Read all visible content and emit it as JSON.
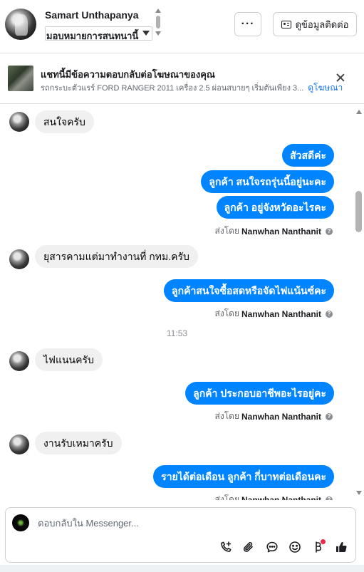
{
  "header": {
    "contact_name": "Samart Unthapanya",
    "assign_value": "มอบหมายการสนทนานี้",
    "more_label": "···",
    "contact_info_label": "ดูข้อมูลติดต่อ"
  },
  "ad_banner": {
    "title": "แชทนี้มีข้อความตอบกลับต่อโฆษณาของคุณ",
    "subtitle": "รถกระบะตัวแรร์ FORD RANGER 2011 เครื่อง 2.5 ผ่อนสบายๆ เริ่มต้นเพียง 3...",
    "link": "ดูโฆษณา"
  },
  "messages": {
    "m1": "สนใจครับ",
    "m2": "สัวสดีค่ะ",
    "m3": "ลูกค้า สนใจรถรุ่นนี้อยู่นะคะ",
    "m4": "ลูกค้า อยู่จังหวัดอะไรคะ",
    "m5": "ยุสารคามแต่มาทำงานที่ กทม.ครับ",
    "m6": "ลูกค้าสนใจซื้อสดหรือจัดไฟแน้นซ์คะ",
    "m7": "ไฟแนนครับ",
    "m8": "ลูกค้า ประกอบอาชีพอะไรอยู่คะ",
    "m9": "งานรับเหมาครับ",
    "m10": "รายได้ต่อเดือน ลูกค้า กี่บาทต่อเดือนคะ"
  },
  "sent_by": {
    "prefix": "ส่งโดย",
    "name": "Nanwhan Nanthanit"
  },
  "time_divider": "11:53",
  "composer": {
    "placeholder": "ตอบกลับใน Messenger..."
  },
  "icons": [
    "call-plus-icon",
    "attach-icon",
    "saved-reply-icon",
    "emoji-icon",
    "currency-icon",
    "like-icon"
  ],
  "colors": {
    "outgoing_bubble": "#0084ff",
    "incoming_bubble": "#f0f0f0",
    "link": "#1877f2",
    "notification_dot": "#f02849"
  }
}
